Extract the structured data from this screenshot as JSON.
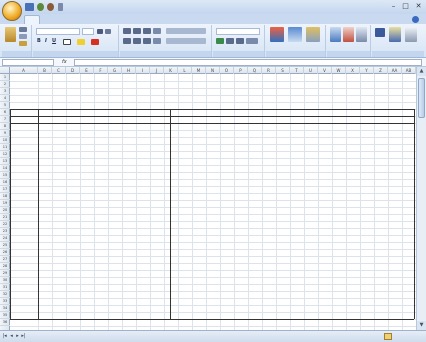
{
  "window": {
    "title": "",
    "office_button": "",
    "controls": [
      "–",
      "□",
      "✕"
    ],
    "colors": {
      "titlebar": "#c3d6ee",
      "ribbon": "#d6e4f5",
      "grid_line": "#dde3ea"
    }
  },
  "ribbon": {
    "tabs": [
      "",
      "",
      "",
      "",
      "",
      "",
      "",
      ""
    ],
    "font_name": "",
    "font_size": "",
    "buttons": {
      "bold": "B",
      "italic": "I",
      "underline": "U"
    }
  },
  "formula_bar": {
    "name_box": "",
    "fx": "fx",
    "content": ""
  },
  "columns": [
    "A",
    "B",
    "C",
    "D",
    "E",
    "F",
    "G",
    "H",
    "I",
    "J",
    "K",
    "L",
    "M",
    "N",
    "O",
    "P",
    "Q",
    "R",
    "S",
    "T",
    "U",
    "V",
    "W",
    "X",
    "Y",
    "Z",
    "AA",
    "AB",
    "AC",
    "AD"
  ],
  "rows": [
    "1",
    "2",
    "3",
    "4",
    "5",
    "6",
    "7",
    "8",
    "9",
    "10",
    "11",
    "12",
    "13",
    "14",
    "15",
    "16",
    "17",
    "18",
    "19",
    "20",
    "21",
    "22",
    "23",
    "24",
    "25",
    "26",
    "27",
    "28",
    "29",
    "30",
    "31",
    "32",
    "33",
    "34",
    "35",
    "36"
  ],
  "sheet": {
    "title_spaced": "",
    "col_label_a": "",
    "col_label_b": "",
    "left_header": "",
    "left_sub": "",
    "section_label": "",
    "right_note": "",
    "row_labels": [],
    "data_rows": []
  },
  "sheet_tabs": {
    "active_index": 0,
    "nav": [
      "|◂",
      "◂",
      "▸",
      "▸|"
    ],
    "tabs": []
  }
}
